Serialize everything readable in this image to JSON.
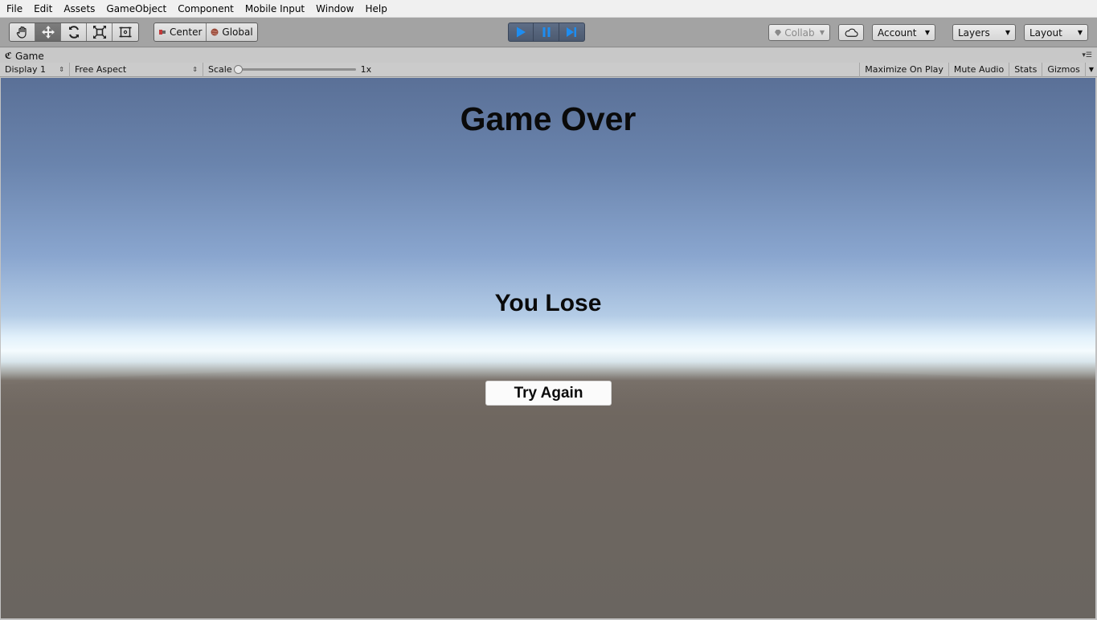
{
  "menu": [
    "File",
    "Edit",
    "Assets",
    "GameObject",
    "Component",
    "Mobile Input",
    "Window",
    "Help"
  ],
  "toolbar": {
    "tools": [
      {
        "name": "hand-tool-icon",
        "active": false
      },
      {
        "name": "move-tool-icon",
        "active": true
      },
      {
        "name": "rotate-tool-icon",
        "active": false
      },
      {
        "name": "scale-tool-icon",
        "active": false
      },
      {
        "name": "rect-tool-icon",
        "active": false
      }
    ],
    "pivot_label": "Center",
    "space_label": "Global",
    "collab_label": "Collab",
    "account_label": "Account",
    "layers_label": "Layers",
    "layout_label": "Layout",
    "play_active": true,
    "accent_color": "#1e8df0"
  },
  "game_tab": {
    "label": "Game",
    "display": "Display 1",
    "aspect": "Free Aspect",
    "scale_label": "Scale",
    "scale_value": "1x",
    "maximize": "Maximize On Play",
    "mute": "Mute Audio",
    "stats": "Stats",
    "gizmos": "Gizmos"
  },
  "game": {
    "title": "Game Over",
    "subtitle": "You Lose",
    "button": "Try Again"
  }
}
